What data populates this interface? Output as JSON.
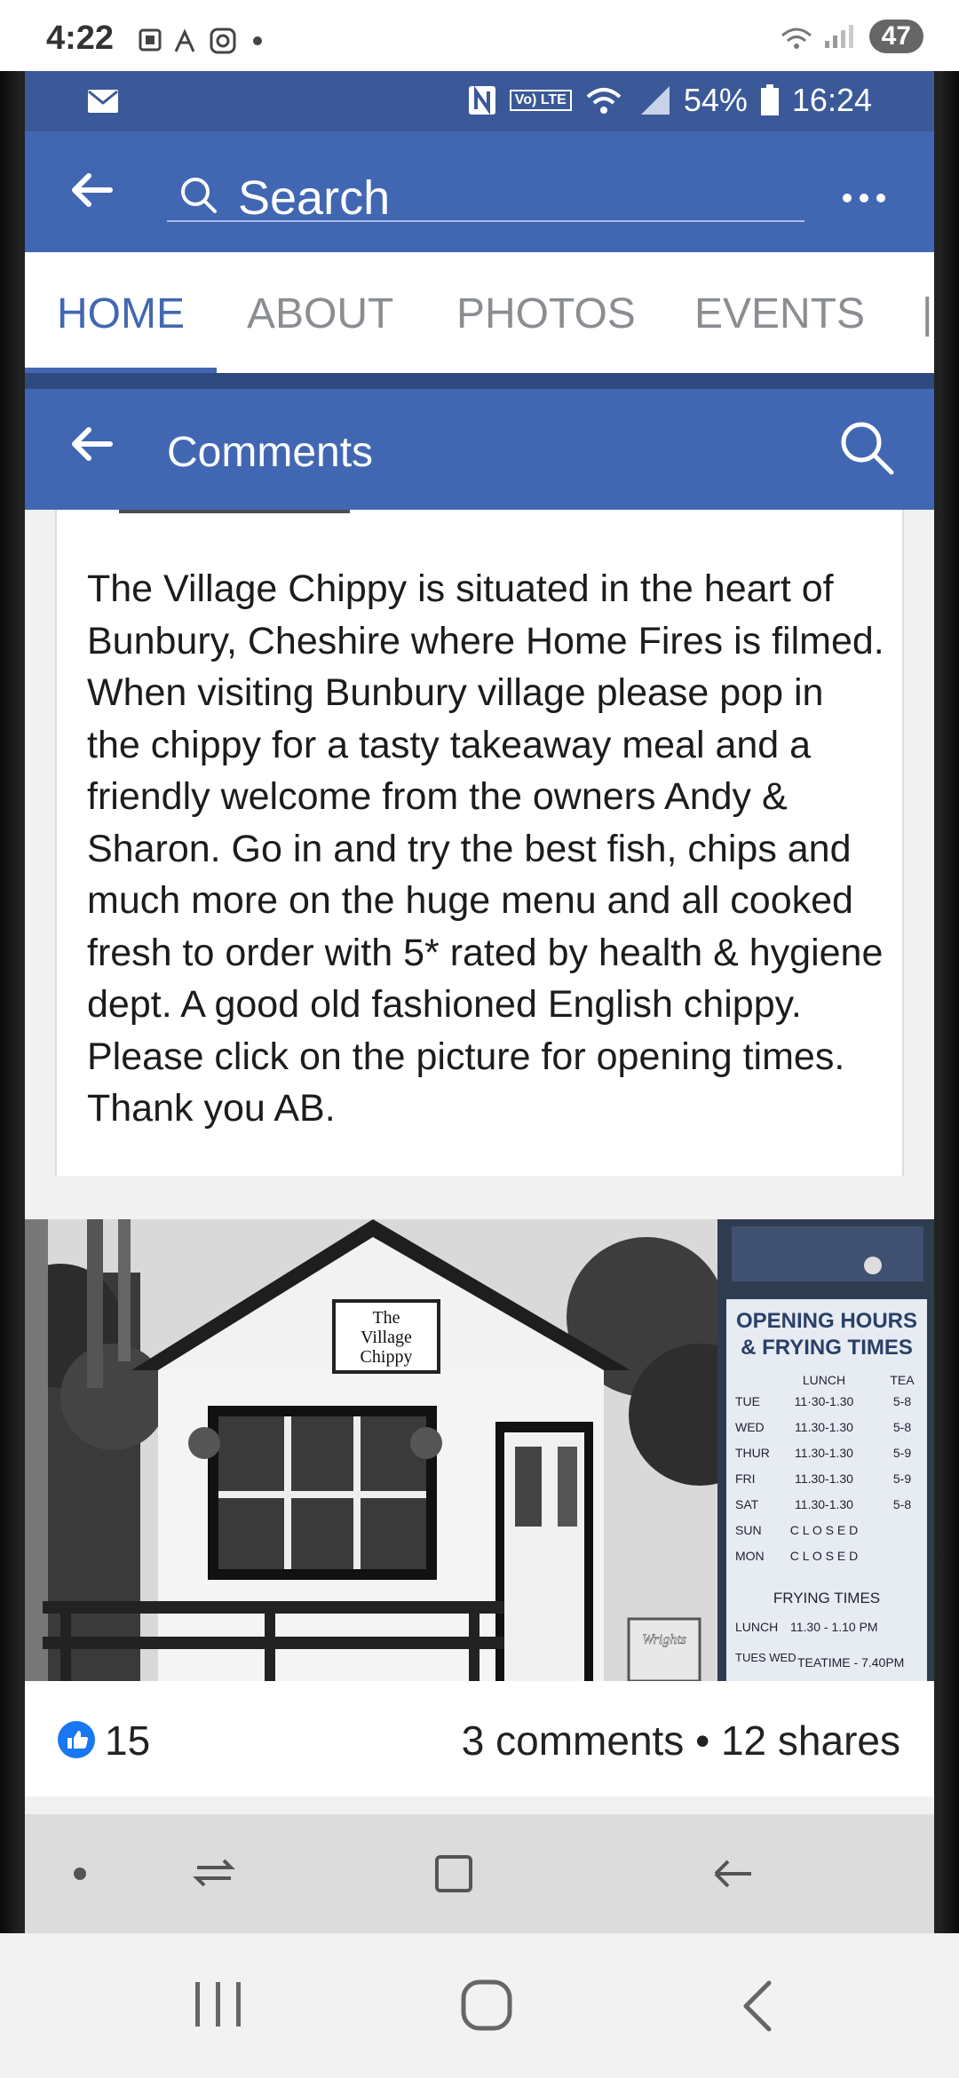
{
  "outer_status": {
    "time": "4:22",
    "battery": "47"
  },
  "inner_status": {
    "battery_percent": "54%",
    "time": "16:24",
    "network_badge_1": "Vo) LTE"
  },
  "search": {
    "placeholder": "Search"
  },
  "tabs": [
    {
      "label": "HOME"
    },
    {
      "label": "ABOUT"
    },
    {
      "label": "PHOTOS"
    },
    {
      "label": "EVENTS"
    }
  ],
  "comments_header": {
    "title": "Comments"
  },
  "post": {
    "body": "The Village Chippy is situated in the heart of Bunbury, Cheshire where Home Fires is filmed. When visiting Bunbury village please pop in the chippy for a tasty takeaway meal and a friendly welcome from the owners Andy & Sharon. Go in and try the best fish, chips and much more on the huge menu and all cooked fresh to order with 5* rated by health & hygiene dept. A good old fashioned English chippy. Please click on the picture for opening times. Thank you AB."
  },
  "photo": {
    "shop_sign": [
      "The",
      "Village",
      "Chippy"
    ],
    "hours_title_1": "OPENING HOURS",
    "hours_title_2": "& FRYING TIMES",
    "hours_col_lunch": "LUNCH",
    "hours_col_tea": "TEA",
    "hours_rows": [
      {
        "day": "TUE",
        "lunch": "11·30-1.30",
        "tea": "5-8"
      },
      {
        "day": "WED",
        "lunch": "11.30-1.30",
        "tea": "5-8"
      },
      {
        "day": "THUR",
        "lunch": "11.30-1.30",
        "tea": "5-9"
      },
      {
        "day": "FRI",
        "lunch": "11.30-1.30",
        "tea": "5-9"
      },
      {
        "day": "SAT",
        "lunch": "11.30-1.30",
        "tea": "5-8"
      },
      {
        "day": "SUN",
        "lunch": "C L O S E D",
        "tea": ""
      },
      {
        "day": "MON",
        "lunch": "C L O S E D",
        "tea": ""
      }
    ],
    "frying_title": "FRYING TIMES",
    "frying_lunch_label": "LUNCH",
    "frying_lunch_time": "11.30 - 1.10 PM",
    "frying_days": "TUES WED",
    "frying_teatime": "TEATIME - 7.40PM",
    "crate_label": "Wrights"
  },
  "engagement": {
    "likes": "15",
    "stats": "3 comments • 12 shares"
  },
  "colors": {
    "facebook_blue": "#4267b2",
    "status_blue": "#3b5998"
  }
}
